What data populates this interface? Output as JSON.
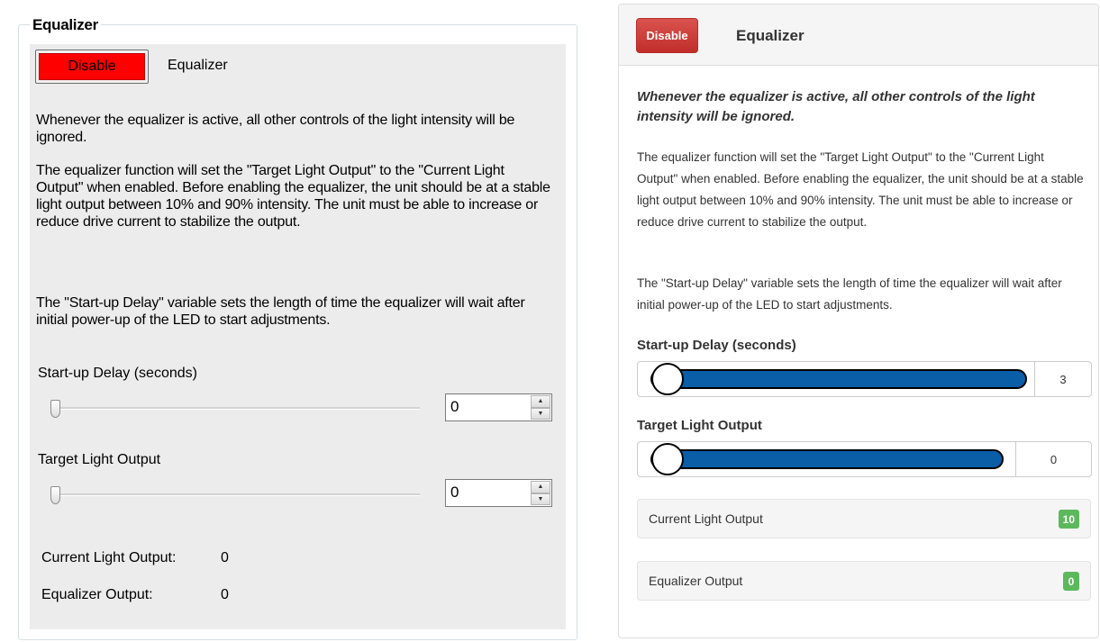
{
  "classic": {
    "group_title": "Equalizer",
    "disable_label": "Disable",
    "equalizer_label": "Equalizer",
    "paragraph1": "Whenever the equalizer is active, all other controls of the light intensity will be ignored.",
    "paragraph2": "The equalizer function will set the \"Target Light Output\" to the \"Current Light Output\" when enabled. Before enabling the equalizer, the unit should be at a stable light output between 10% and 90% intensity. The unit must be able to increase or reduce drive current to stabilize the output.",
    "paragraph3": "The \"Start-up Delay\" variable sets the length of time the equalizer will wait after initial power-up of the LED to start adjustments.",
    "startup_label": "Start-up Delay (seconds)",
    "startup_value": "0",
    "target_label": "Target Light Output",
    "target_value": "0",
    "current_output_label": "Current Light Output:",
    "current_output_value": "0",
    "equalizer_output_label": "Equalizer Output:",
    "equalizer_output_value": "0",
    "disable_color": "#ff0000"
  },
  "web": {
    "disable_label": "Disable",
    "title": "Equalizer",
    "warning": "Whenever the equalizer is active, all other controls of the light intensity will be ignored.",
    "paragraph1": "The equalizer function will set the \"Target Light Output\" to the \"Current Light Output\" when enabled. Before enabling the equalizer, the unit should be at a stable light output between 10% and 90% intensity. The unit must be able to increase or reduce drive current to stabilize the output.",
    "paragraph2": "The \"Start-up Delay\" variable sets the length of time the equalizer will wait after initial power-up of the LED to start adjustments.",
    "startup_label": "Start-up Delay (seconds)",
    "startup_value": "3",
    "target_label": "Target Light Output",
    "target_value": "0",
    "current_output_label": "Current Light Output",
    "current_output_value": "10",
    "equalizer_output_label": "Equalizer Output",
    "equalizer_output_value": "0",
    "disable_color": "#d9534f",
    "slider_color": "#0a5ea8",
    "badge_color": "#5cb85c"
  }
}
